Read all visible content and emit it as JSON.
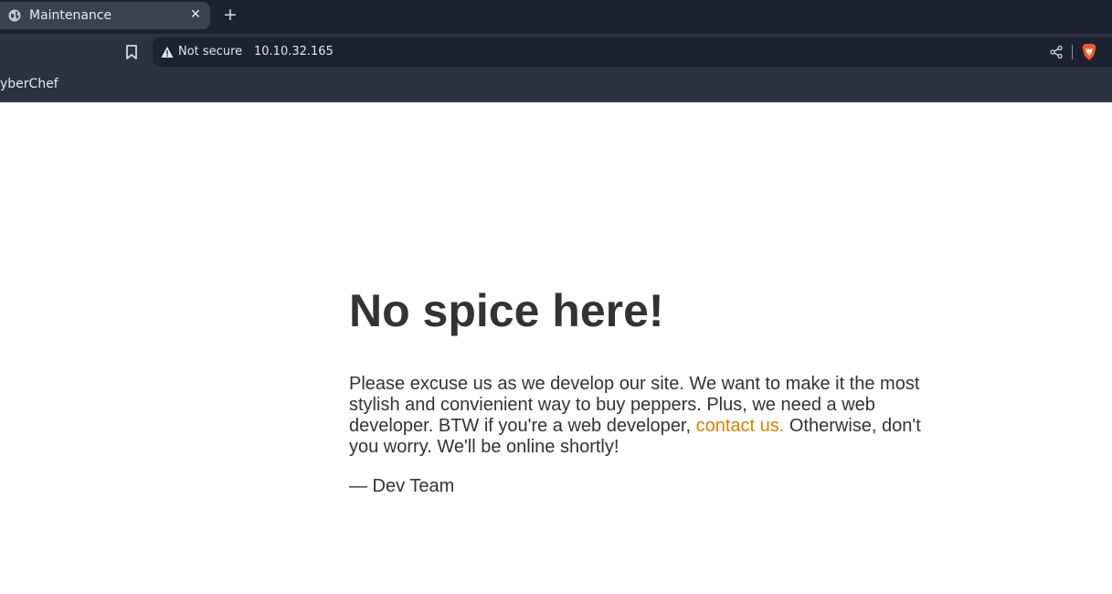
{
  "browser": {
    "tab": {
      "title": "Maintenance",
      "close_glyph": "✕",
      "icon": "globe-icon"
    },
    "new_tab_glyph": "+",
    "toolbar": {
      "bookmark_icon": "bookmark-icon",
      "security_label": "Not secure",
      "url": "10.10.32.165",
      "share_icon": "share-icon",
      "brave_icon": "brave-lion-icon"
    },
    "bookmarks_bar": {
      "items": [
        "yberChef"
      ]
    }
  },
  "page": {
    "heading": "No spice here!",
    "paragraph_before_link": "Please excuse us as we develop our site. We want to make it the most stylish and convienient way to buy peppers. Plus, we need a web developer. BTW if you're a web developer, ",
    "link_text": "contact us.",
    "paragraph_after_link": " Otherwise, don't you worry. We'll be online shortly!",
    "signature": "— Dev Team",
    "link_color": "#dc8100",
    "text_color": "#333333"
  }
}
